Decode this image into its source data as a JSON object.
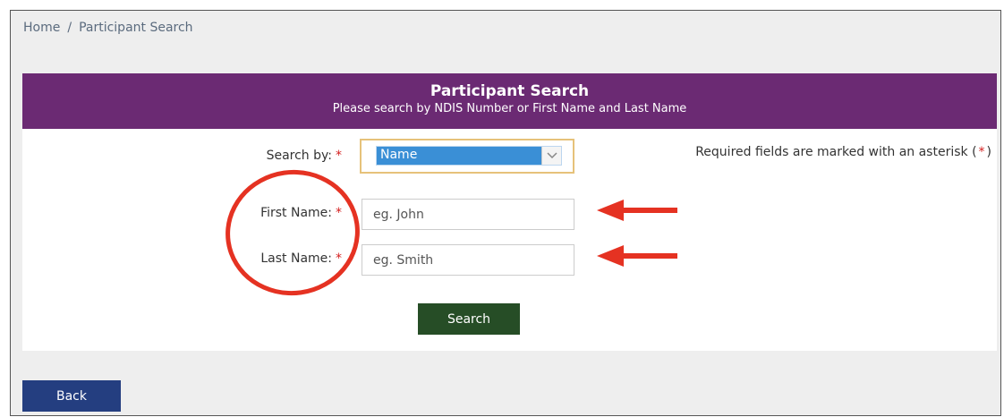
{
  "breadcrumb": {
    "home": "Home",
    "separator": "/",
    "current": "Participant Search"
  },
  "panel": {
    "title": "Participant Search",
    "subtitle": "Please search by NDIS Number or First Name and Last Name"
  },
  "form": {
    "search_by": {
      "label": "Search by:",
      "required_mark": "*",
      "selected_value": "Name"
    },
    "first_name": {
      "label": "First Name:",
      "required_mark": "*",
      "placeholder": "eg. John",
      "value": ""
    },
    "last_name": {
      "label": "Last Name:",
      "required_mark": "*",
      "placeholder": "eg. Smith",
      "value": ""
    },
    "required_note": {
      "text_before": "Required fields are marked with an asterisk (",
      "mark": "*",
      "text_after": ")"
    },
    "search_button": "Search"
  },
  "back_button": "Back",
  "colors": {
    "header_purple": "#6b2a73",
    "search_button_green": "#264d26",
    "back_button_blue": "#243e80",
    "annotation_red": "#e53222",
    "required_red": "#d42020"
  },
  "icons": {
    "dropdown": "chevron-down-icon",
    "annotation_arrows": "arrow-left-icon"
  }
}
